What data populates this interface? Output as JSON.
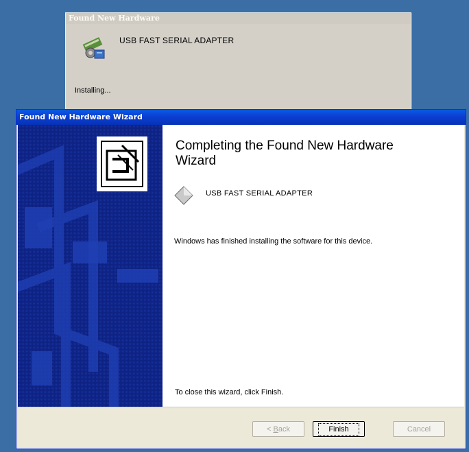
{
  "notification": {
    "title": "Found New Hardware",
    "device_name": "USB FAST SERIAL ADAPTER",
    "status": "Installing..."
  },
  "wizard": {
    "title": "Found New Hardware Wizard",
    "heading": "Completing the Found New Hardware Wizard",
    "device_name": "USB FAST SERIAL ADAPTER",
    "finished_text": "Windows has finished installing the software for this device.",
    "close_hint": "To close this wizard, click Finish.",
    "buttons": {
      "back_prefix": "< ",
      "back_underline": "B",
      "back_rest": "ack",
      "finish": "Finish",
      "cancel": "Cancel"
    }
  },
  "colors": {
    "desktop": "#3a6ea5",
    "titlebar": "#0b3fd1",
    "banner": "#0e2283",
    "dialog_face": "#ece9d8"
  }
}
